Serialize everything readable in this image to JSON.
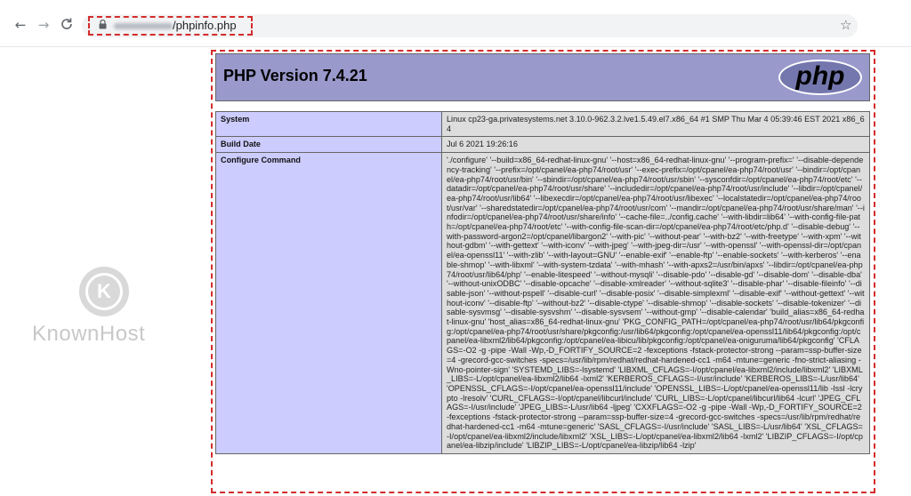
{
  "browser": {
    "back_icon": "←",
    "forward_icon": "→",
    "reload_icon": "C",
    "lock_icon": "🔒",
    "url_path": "/phpinfo.php",
    "bookmark_icon": "☆"
  },
  "watermark": {
    "logo_letter": "K",
    "brand": "KnownHost"
  },
  "phpinfo": {
    "title": "PHP Version 7.4.21",
    "logo_text": "php",
    "rows": [
      {
        "key": "System",
        "value": "Linux cp23-ga.privatesystems.net 3.10.0-962.3.2.lve1.5.49.el7.x86_64 #1 SMP Thu Mar 4 05:39:46 EST 2021 x86_64"
      },
      {
        "key": "Build Date",
        "value": "Jul 6 2021 19:26:16"
      },
      {
        "key": "Configure Command",
        "value": "'./configure' '--build=x86_64-redhat-linux-gnu' '--host=x86_64-redhat-linux-gnu' '--program-prefix=' '--disable-dependency-tracking' '--prefix=/opt/cpanel/ea-php74/root/usr' '--exec-prefix=/opt/cpanel/ea-php74/root/usr' '--bindir=/opt/cpanel/ea-php74/root/usr/bin' '--sbindir=/opt/cpanel/ea-php74/root/usr/sbin' '--sysconfdir=/opt/cpanel/ea-php74/root/etc' '--datadir=/opt/cpanel/ea-php74/root/usr/share' '--includedir=/opt/cpanel/ea-php74/root/usr/include' '--libdir=/opt/cpanel/ea-php74/root/usr/lib64' '--libexecdir=/opt/cpanel/ea-php74/root/usr/libexec' '--localstatedir=/opt/cpanel/ea-php74/root/usr/var' '--sharedstatedir=/opt/cpanel/ea-php74/root/usr/com' '--mandir=/opt/cpanel/ea-php74/root/usr/share/man' '--infodir=/opt/cpanel/ea-php74/root/usr/share/info' '--cache-file=../config.cache' '--with-libdir=lib64' '--with-config-file-path=/opt/cpanel/ea-php74/root/etc' '--with-config-file-scan-dir=/opt/cpanel/ea-php74/root/etc/php.d' '--disable-debug' '--with-password-argon2=/opt/cpanel/libargon2' '--with-pic' '--without-pear' '--with-bz2' '--with-freetype' '--with-xpm' '--without-gdbm' '--with-gettext' '--with-iconv' '--with-jpeg' '--with-jpeg-dir=/usr' '--with-openssl' '--with-openssl-dir=/opt/cpanel/ea-openssl11' '--with-zlib' '--with-layout=GNU' '--enable-exif' '--enable-ftp' '--enable-sockets' '--with-kerberos' '--enable-shmop' '--with-libxml' '--with-system-tzdata' '--with-mhash' '--with-apxs2=/usr/bin/apxs' '--libdir=/opt/cpanel/ea-php74/root/usr/lib64/php' '--enable-litespeed' '--without-mysqli' '--disable-pdo' '--disable-gd' '--disable-dom' '--disable-dba' '--without-unixODBC' '--disable-opcache' '--disable-xmlreader' '--without-sqlite3' '--disable-phar' '--disable-fileinfo' '--disable-json' '--without-pspell' '--disable-curl' '--disable-posix' '--disable-simplexml' '--disable-exif' '--without-gettext' '--without-iconv' '--disable-ftp' '--without-bz2' '--disable-ctype' '--disable-shmop' '--disable-sockets' '--disable-tokenizer' '--disable-sysvmsg' '--disable-sysvshm' '--disable-sysvsem' '--without-gmp' '--disable-calendar' 'build_alias=x86_64-redhat-linux-gnu' 'host_alias=x86_64-redhat-linux-gnu' 'PKG_CONFIG_PATH=/opt/cpanel/ea-php74/root/usr/lib64/pkgconfig:/opt/cpanel/ea-php74/root/usr/share/pkgconfig:/usr/lib64/pkgconfig:/opt/cpanel/ea-openssl11/lib64/pkgconfig:/opt/cpanel/ea-libxml2/lib64/pkgconfig:/opt/cpanel/ea-libicu/lib/pkgconfig:/opt/cpanel/ea-oniguruma/lib64/pkgconfig' 'CFLAGS=-O2 -g -pipe -Wall -Wp,-D_FORTIFY_SOURCE=2 -fexceptions -fstack-protector-strong --param=ssp-buffer-size=4 -grecord-gcc-switches -specs=/usr/lib/rpm/redhat/redhat-hardened-cc1 -m64 -mtune=generic -fno-strict-aliasing -Wno-pointer-sign' 'SYSTEMD_LIBS=-lsystemd' 'LIBXML_CFLAGS=-I/opt/cpanel/ea-libxml2/include/libxml2' 'LIBXML_LIBS=-L/opt/cpanel/ea-libxml2/lib64 -lxml2' 'KERBEROS_CFLAGS=-I/usr/include' 'KERBEROS_LIBS=-L/usr/lib64' 'OPENSSL_CFLAGS=-I/opt/cpanel/ea-openssl11/include' 'OPENSSL_LIBS=-L/opt/cpanel/ea-openssl11/lib -lssl -lcrypto -lresolv' 'CURL_CFLAGS=-I/opt/cpanel/libcurl/include' 'CURL_LIBS=-L/opt/cpanel/libcurl/lib64 -lcurl' 'JPEG_CFLAGS=-I/usr/include' 'JPEG_LIBS=-L/usr/lib64 -ljpeg' 'CXXFLAGS=-O2 -g -pipe -Wall -Wp,-D_FORTIFY_SOURCE=2 -fexceptions -fstack-protector-strong --param=ssp-buffer-size=4 -grecord-gcc-switches -specs=/usr/lib/rpm/redhat/redhat-hardened-cc1 -m64 -mtune=generic' 'SASL_CFLAGS=-I/usr/include' 'SASL_LIBS=-L/usr/lib64' 'XSL_CFLAGS=-I/opt/cpanel/ea-libxml2/include/libxml2' 'XSL_LIBS=-L/opt/cpanel/ea-libxml2/lib64 -lxml2' 'LIBZIP_CFLAGS=-I/opt/cpanel/ea-libzip/include' 'LIBZIP_LIBS=-L/opt/cpanel/ea-libzip/lib64 -lzip'"
      }
    ]
  }
}
